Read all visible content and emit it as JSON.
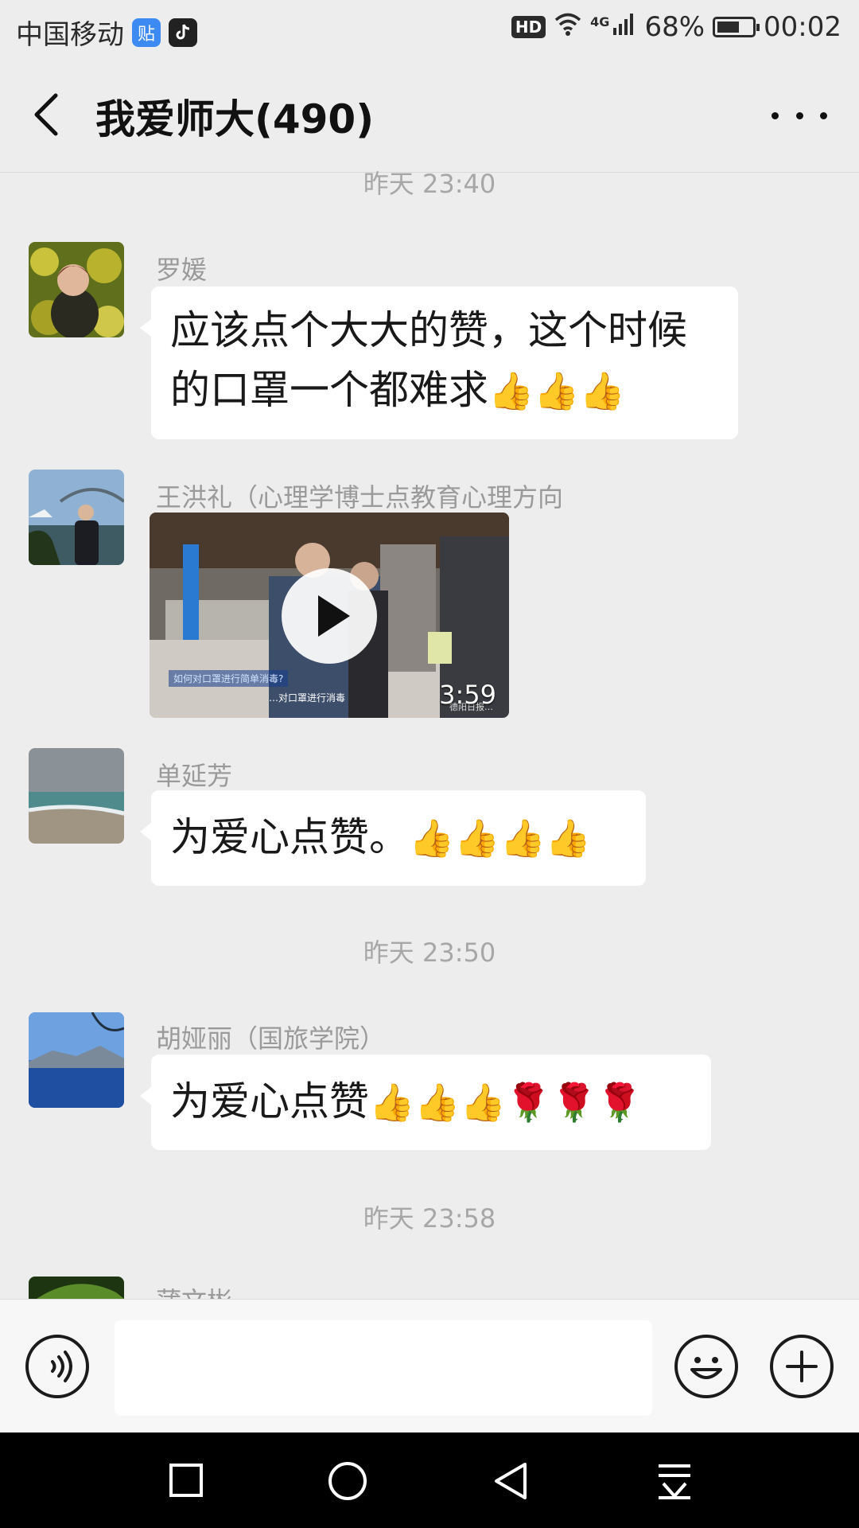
{
  "status_bar": {
    "carrier": "中国移动",
    "app1": "贴",
    "hd": "HD",
    "network": "4G",
    "battery": "68%",
    "battery_level": 0.68,
    "time": "00:02"
  },
  "header": {
    "title": "我爱师大(490)"
  },
  "timestamps": [
    "昨天 23:40",
    "昨天 23:50",
    "昨天 23:58"
  ],
  "messages": [
    {
      "sender": "罗媛",
      "text_line1": "应该点个大大的赞，这个时候",
      "text_line2": "的口罩一个都难求",
      "emoji": "👍👍👍"
    },
    {
      "sender": "王洪礼（心理学博士点教育心理方向",
      "video": {
        "duration": "3:59",
        "caption1": "如何对口罩进行简单消毒?",
        "caption2": "…对口罩进行消毒",
        "caption3": "德阳日报…"
      }
    },
    {
      "sender": "单延芳",
      "text": "为爱心点赞。",
      "emoji": "👍👍👍👍"
    },
    {
      "sender": "胡娅丽（国旅学院）",
      "text": "为爱心点赞",
      "emoji": "👍👍👍🌹🌹🌹"
    },
    {
      "sender": "蒲文彬"
    }
  ],
  "input_bar": {
    "placeholder": ""
  }
}
